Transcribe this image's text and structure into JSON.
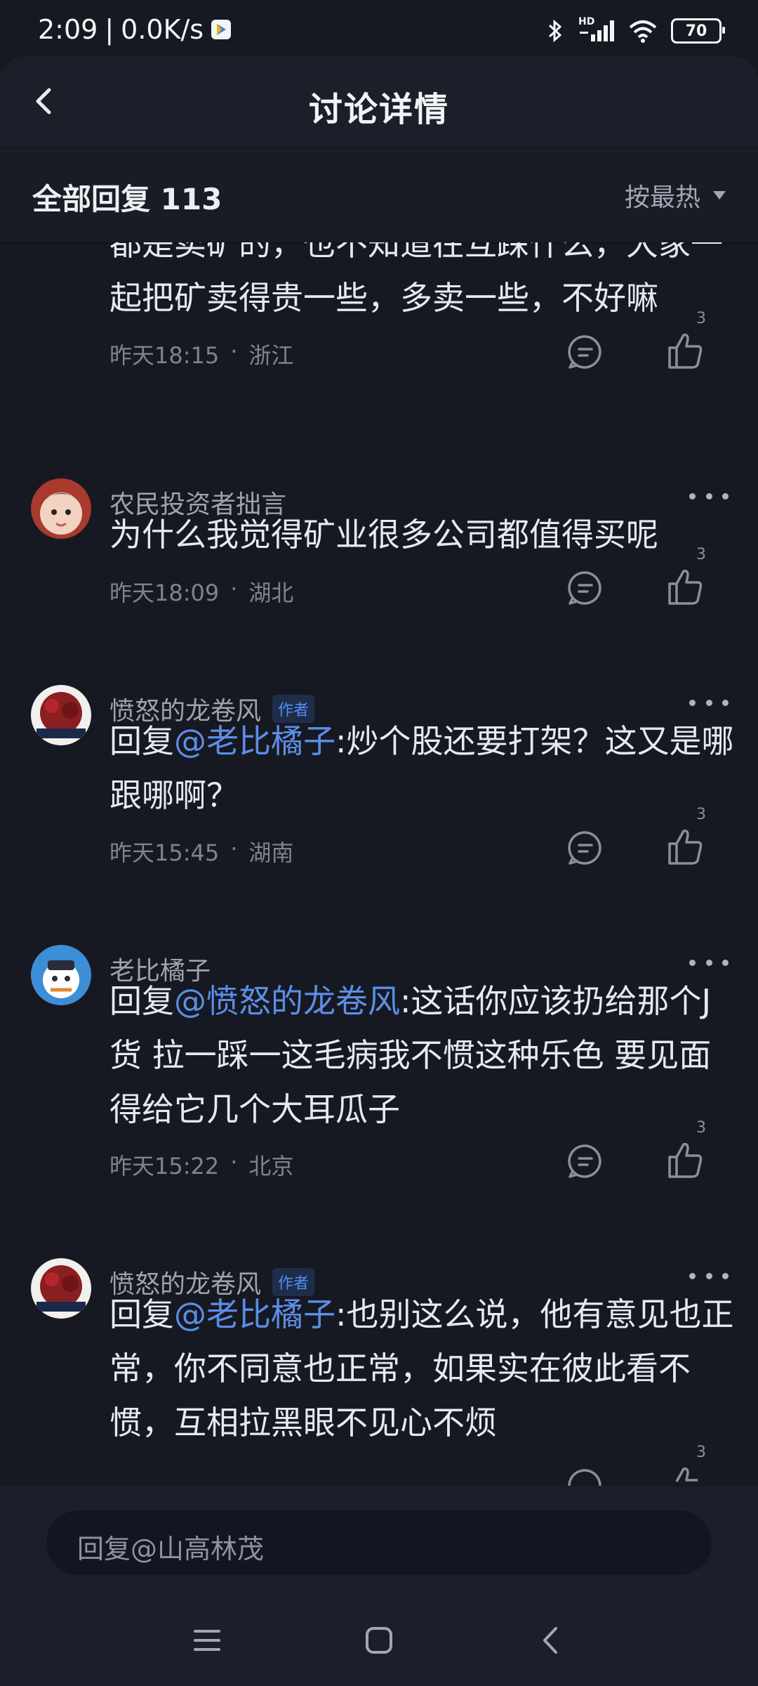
{
  "status": {
    "time": "2:09",
    "separator": "|",
    "speed": "0.0K/s",
    "signal_label": "HD",
    "battery": "70"
  },
  "nav": {
    "title": "讨论详情",
    "back_icon": "chevron-left-icon"
  },
  "subheader": {
    "title": "全部回复 113",
    "sort_label": "按最热"
  },
  "comments": [
    {
      "name": "",
      "tag": "",
      "segments": [
        {
          "text": "都是卖矿的，也不知道在互踩什么，大家一起把矿卖得贵一些，多卖一些，不好嘛",
          "mention": false
        }
      ],
      "time": "昨天18:15",
      "dot": "·",
      "location": "浙江",
      "likes": "3"
    },
    {
      "name": "农民投资者拙言",
      "tag": "",
      "segments": [
        {
          "text": "为什么我觉得矿业很多公司都值得买呢",
          "mention": false
        }
      ],
      "time": "昨天18:09",
      "dot": "·",
      "location": "湖北",
      "likes": "3"
    },
    {
      "name": "愤怒的龙卷风",
      "tag": "作者",
      "segments": [
        {
          "text": "回复",
          "mention": false
        },
        {
          "text": "@老比橘子",
          "mention": true
        },
        {
          "text": ":炒个股还要打架？这又是哪跟哪啊？",
          "mention": false
        }
      ],
      "time": "昨天15:45",
      "dot": "·",
      "location": "湖南",
      "likes": "3"
    },
    {
      "name": "老比橘子",
      "tag": "",
      "segments": [
        {
          "text": "回复",
          "mention": false
        },
        {
          "text": "@愤怒的龙卷风",
          "mention": true
        },
        {
          "text": ":这话你应该扔给那个J货 拉一踩一这毛病我不惯这种乐色 要见面得给它几个大耳瓜子",
          "mention": false
        }
      ],
      "time": "昨天15:22",
      "dot": "·",
      "location": "北京",
      "likes": "3"
    },
    {
      "name": "愤怒的龙卷风",
      "tag": "作者",
      "segments": [
        {
          "text": "回复",
          "mention": false
        },
        {
          "text": "@老比橘子",
          "mention": true
        },
        {
          "text": ":也别这么说，他有意见也正常，你不同意也正常，如果实在彼此看不惯，互相拉黑眼不见心不烦",
          "mention": false
        }
      ],
      "time": "",
      "dot": "",
      "location": "",
      "likes": "3"
    }
  ],
  "input": {
    "placeholder": "回复@山高林茂"
  },
  "system_nav": {
    "menu_icon": "menu-icon",
    "home_icon": "home-square-icon",
    "back_icon": "back-chevron-icon"
  },
  "colors": {
    "background": "#171922",
    "mention": "#5c8ee8",
    "author_tag": "#4f8df7"
  }
}
